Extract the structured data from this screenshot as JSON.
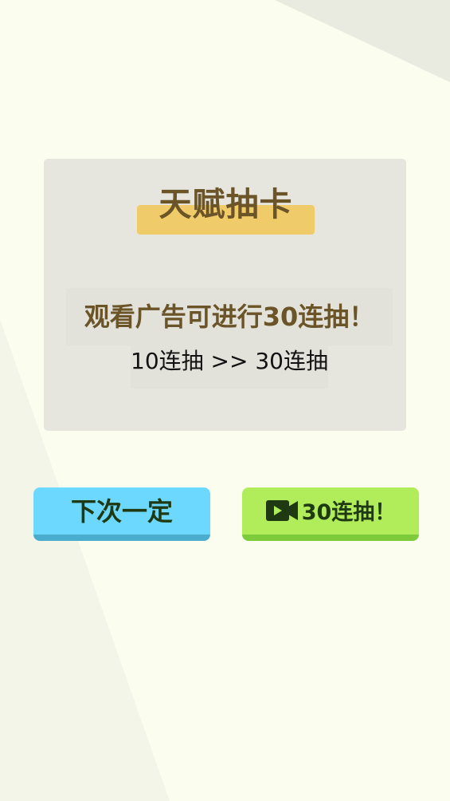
{
  "dialog": {
    "title": "天赋抽卡",
    "message": "观看广告可进行30连抽！",
    "sub_message": "10连抽 >> 30连抽"
  },
  "buttons": {
    "next_time_label": "下次一定",
    "more_draws_label": "30连抽！",
    "more_draws_icon": "video-camera-icon"
  },
  "colors": {
    "background": "#fbfdef",
    "panel": "#e6e5de",
    "title_bar": "#f0cb69",
    "title_text": "#6a5428",
    "next_button": "#6dd8fd",
    "more_button": "#b1ed5a"
  }
}
